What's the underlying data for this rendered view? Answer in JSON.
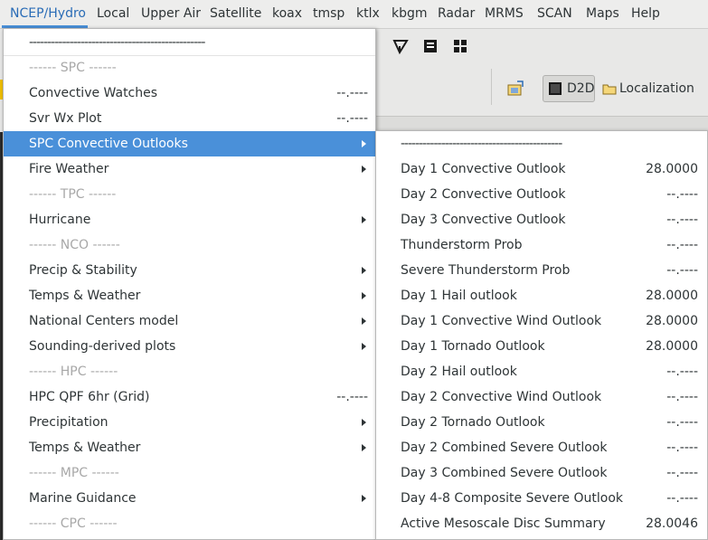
{
  "menubar": {
    "items": [
      "NCEP/Hydro",
      "Local",
      "Upper Air",
      "Satellite",
      "koax",
      "tmsp",
      "ktlx",
      "kbgm",
      "Radar",
      "MRMS",
      "SCAN",
      "Maps",
      "Help"
    ],
    "active": "NCEP/Hydro"
  },
  "toolbar": {
    "d2d_label": "D2D",
    "localization_label": "Localization"
  },
  "menu": {
    "dash_line": "------------------------------------------------",
    "rows": [
      {
        "label": "------ SPC ------",
        "kind": "separator"
      },
      {
        "label": "Convective Watches",
        "value": "--.----"
      },
      {
        "label": "Svr Wx Plot",
        "value": "--.----"
      },
      {
        "label": "SPC Convective Outlooks",
        "submenu": true,
        "highlighted": true
      },
      {
        "label": "Fire Weather",
        "submenu": true
      },
      {
        "label": "------ TPC ------",
        "kind": "separator"
      },
      {
        "label": "Hurricane",
        "submenu": true
      },
      {
        "label": "------ NCO ------",
        "kind": "separator"
      },
      {
        "label": "Precip & Stability",
        "submenu": true
      },
      {
        "label": "Temps & Weather",
        "submenu": true
      },
      {
        "label": "National Centers model",
        "submenu": true
      },
      {
        "label": "Sounding-derived plots",
        "submenu": true
      },
      {
        "label": "------ HPC ------",
        "kind": "separator"
      },
      {
        "label": "HPC QPF 6hr (Grid)",
        "value": "--.----"
      },
      {
        "label": "Precipitation",
        "submenu": true
      },
      {
        "label": "Temps & Weather",
        "submenu": true
      },
      {
        "label": "------ MPC ------",
        "kind": "separator"
      },
      {
        "label": "Marine Guidance",
        "submenu": true
      },
      {
        "label": "------ CPC ------",
        "kind": "separator"
      }
    ]
  },
  "submenu": {
    "dash_line": "--------------------------------------------",
    "rows": [
      {
        "label": "Day 1 Convective Outlook",
        "value": "28.0000"
      },
      {
        "label": "Day 2 Convective Outlook",
        "value": "--.----"
      },
      {
        "label": "Day 3 Convective Outlook",
        "value": "--.----"
      },
      {
        "label": "Thunderstorm Prob",
        "value": "--.----"
      },
      {
        "label": "Severe Thunderstorm Prob",
        "value": "--.----"
      },
      {
        "label": "Day 1 Hail outlook",
        "value": "28.0000"
      },
      {
        "label": "Day 1 Convective Wind Outlook",
        "value": "28.0000"
      },
      {
        "label": "Day 1 Tornado Outlook",
        "value": "28.0000"
      },
      {
        "label": "Day 2 Hail outlook",
        "value": "--.----"
      },
      {
        "label": "Day 2 Convective Wind Outlook",
        "value": "--.----"
      },
      {
        "label": "Day 2 Tornado Outlook",
        "value": "--.----"
      },
      {
        "label": "Day 2 Combined Severe Outlook",
        "value": "--.----"
      },
      {
        "label": "Day 3 Combined Severe Outlook",
        "value": "--.----"
      },
      {
        "label": "Day 4-8 Composite Severe Outlook",
        "value": "--.----"
      },
      {
        "label": "Active Mesoscale Disc Summary",
        "value": "28.0046"
      }
    ]
  },
  "colors": {
    "highlight": "#4a90d9",
    "separator_text": "#a8a8a8",
    "active_menu_text": "#2a6cb6"
  }
}
